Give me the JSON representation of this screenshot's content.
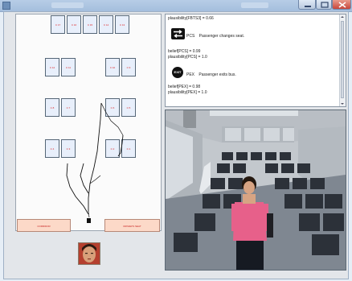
{
  "window": {
    "title": ""
  },
  "seat_map": {
    "top_row": [
      "C 17",
      "C 16",
      "C 15",
      "C 14",
      "C 13"
    ],
    "row2_left": [
      "C 12",
      "C 11"
    ],
    "row2_right": [
      "C 10",
      "C 9"
    ],
    "row3_left": [
      "C 8",
      "C 7"
    ],
    "row3_right": [
      "C 6",
      "C 5"
    ],
    "row4_left": [
      "C 4",
      "C 3"
    ],
    "row4_right": [
      "C 2",
      "C 1"
    ],
    "zones": {
      "corridor": "CORRIDOR",
      "drivers_seat": "DRIVER'S SEAT"
    }
  },
  "event_log": {
    "line1": "plausibility[FBTS3] = 0.66",
    "event1": {
      "icon": "seat-change-icon",
      "code": "PCS",
      "text": "Passenger changes seat."
    },
    "belief1": "belief[PCS] = 0.99",
    "plaus1": "plausibility[PCS] = 1.0",
    "event2": {
      "icon": "exit-icon",
      "icon_text": "EXIT",
      "code": "PEX",
      "text": "Passenger exits bus."
    },
    "belief2": "belief[PEX] = 0.98",
    "plaus2": "plausibility[PEX] = 1.0"
  },
  "colors": {
    "seat_label": "#dd2222",
    "zone_fill": "#fcd9c8",
    "map_bg": "#fbfbfb"
  }
}
